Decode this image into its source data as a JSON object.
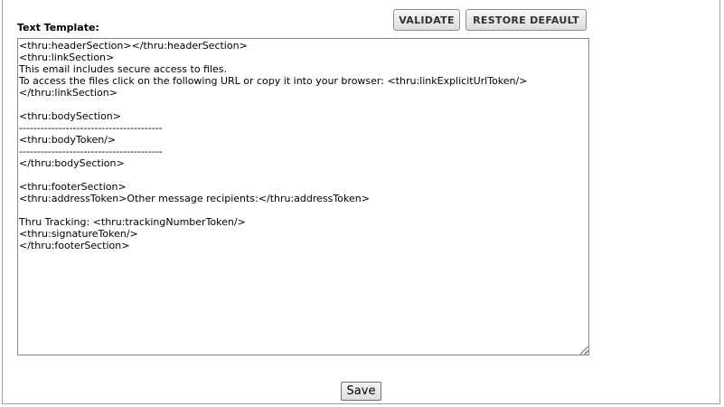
{
  "form": {
    "label": "Text Template:",
    "validate_label": "VALIDATE",
    "restore_label": "RESTORE DEFAULT",
    "template_text": "<thru:headerSection></thru:headerSection>\n<thru:linkSection>\nThis email includes secure access to files.\nTo access the files click on the following URL or copy it into your browser: <thru:linkExplicitUrlToken/>\n</thru:linkSection>\n\n<thru:bodySection>\n----------------------------------------\n<thru:bodyToken/>\n----------------------------------------\n</thru:bodySection>\n\n<thru:footerSection>\n<thru:addressToken>Other message recipients:</thru:addressToken>\n\nThru Tracking: <thru:trackingNumberToken/>\n<thru:signatureToken/>\n</thru:footerSection>",
    "save_label": "Save"
  }
}
